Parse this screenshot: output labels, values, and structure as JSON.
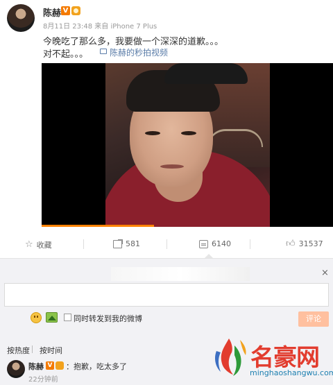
{
  "post": {
    "username": "陈赫",
    "v_badge": "V",
    "meta": "8月11日 23:48 来自 iPhone 7 Plus",
    "text_line1": "今晚吃了那么多，我要做一个深深的道歉。。。",
    "text_line2": "对不起。。。",
    "video_link": "陈赫的秒拍视频",
    "video_progress": 0.385
  },
  "actions": {
    "favorite": "收藏",
    "repost_count": "581",
    "comment_count": "6140",
    "like_count": "31537"
  },
  "comment_box": {
    "close": "×",
    "repost_checkbox_label": "同时转发到我的微博",
    "submit_label": "评论"
  },
  "sort": {
    "by_hot": "按热度",
    "by_time": "按时间"
  },
  "top_comment": {
    "username": "陈赫",
    "v_badge": "V",
    "text": "：抱歉，吃太多了",
    "time": "22分钟前"
  },
  "watermark": {
    "title": "名豪网",
    "url": "minghaoshangwu.com"
  },
  "colors": {
    "accent_orange": "#ff8200",
    "submit_disabled": "#ffc09f",
    "link_blue": "#5a7ca8",
    "watermark_red": "#e23c2e",
    "watermark_blue": "#1c7fb0"
  }
}
